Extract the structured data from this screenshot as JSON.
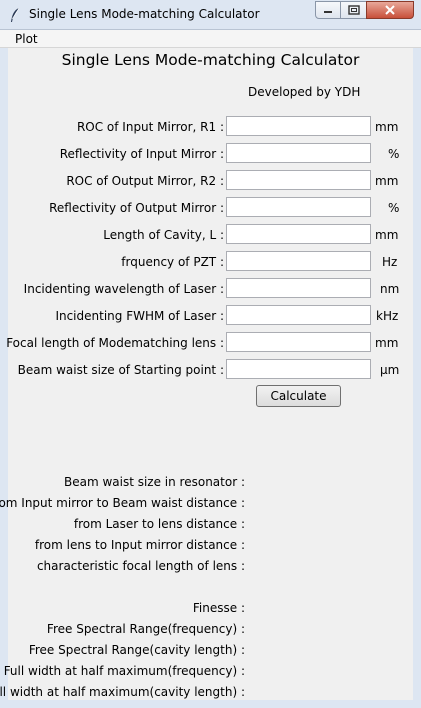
{
  "window": {
    "title": "Single Lens Mode-matching Calculator",
    "min_glyph": "—",
    "max_glyph": "▢",
    "close_glyph": "✕"
  },
  "menu": {
    "plot": "Plot"
  },
  "app": {
    "title": "Single Lens Mode-matching Calculator",
    "developer": "Developed by YDH"
  },
  "inputs": [
    {
      "label": "ROC of Input Mirror, R1 :",
      "value": "",
      "unit": "mm"
    },
    {
      "label": "Reflectivity of Input Mirror :",
      "value": "",
      "unit": "%"
    },
    {
      "label": "ROC of Output Mirror, R2 :",
      "value": "",
      "unit": "mm"
    },
    {
      "label": "Reflectivity of Output Mirror :",
      "value": "",
      "unit": "%"
    },
    {
      "label": "Length of Cavity, L :",
      "value": "",
      "unit": "mm"
    },
    {
      "label": "frquency of PZT :",
      "value": "",
      "unit": "Hz"
    },
    {
      "label": "Incidenting wavelength of Laser :",
      "value": "",
      "unit": "nm"
    },
    {
      "label": "Incidenting FWHM of Laser :",
      "value": "",
      "unit": "kHz"
    },
    {
      "label": "Focal length of Modematching lens :",
      "value": "",
      "unit": "mm"
    },
    {
      "label": "Beam waist size of Starting point :",
      "value": "",
      "unit": "μm"
    }
  ],
  "calculate_label": "Calculate",
  "outputs": [
    "Beam waist size in resonator :",
    "from Input mirror to Beam waist distance :",
    "from Laser to lens distance :",
    "from lens to Input mirror distance :",
    "characteristic focal length of lens :",
    "Finesse :",
    "Free Spectral Range(frequency) :",
    "Free Spectral Range(cavity length) :",
    "Full width at half maximum(frequency) :",
    "Full width at half maximum(cavity length) :"
  ]
}
